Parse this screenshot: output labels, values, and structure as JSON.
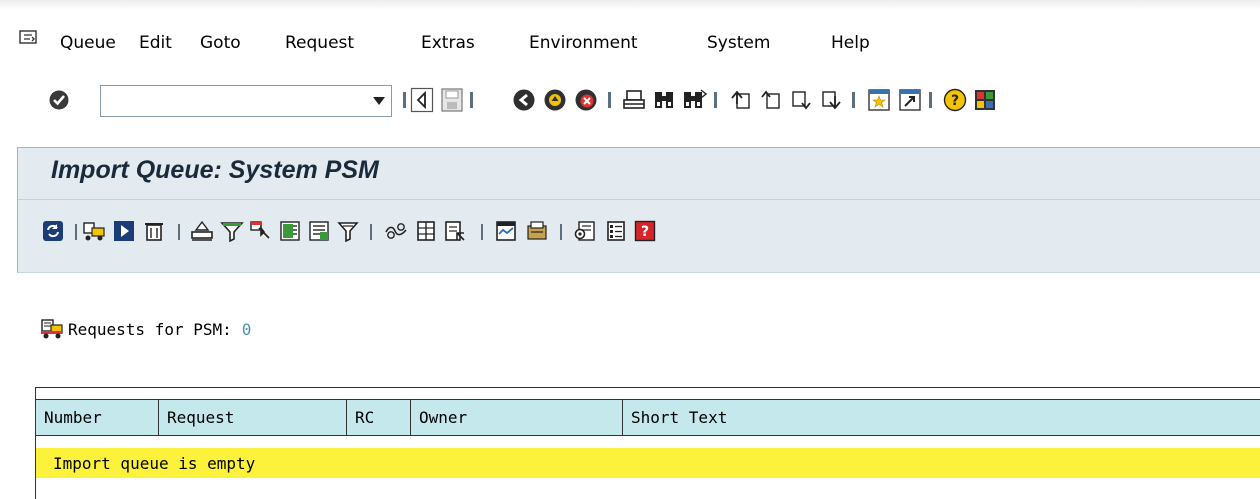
{
  "menu": {
    "items": [
      {
        "label": "Queue"
      },
      {
        "label": "Edit"
      },
      {
        "label": "Goto"
      },
      {
        "label": "Request"
      },
      {
        "label": "Extras"
      },
      {
        "label": "Environment"
      },
      {
        "label": "System"
      },
      {
        "label": "Help"
      }
    ]
  },
  "system_toolbar": {
    "command_field_value": "",
    "icons": [
      "enter-icon",
      "back-icon",
      "save-icon",
      "green-back-icon",
      "exit-icon",
      "cancel-icon",
      "print-icon",
      "find-icon",
      "find-next-icon",
      "first-page-icon",
      "previous-page-icon",
      "next-page-icon",
      "last-page-icon",
      "create-session-icon",
      "shortcut-icon",
      "help-icon",
      "layout-icon"
    ]
  },
  "page": {
    "title": "Import Queue: System PSM"
  },
  "app_toolbar": {
    "icons": [
      "refresh-icon",
      "import-request-icon",
      "start-import-icon",
      "delete-icon",
      "select-icon",
      "filter-icon",
      "select-block-icon",
      "select-all-icon",
      "deselect-all-icon",
      "funnel-icon",
      "logs-icon",
      "details-icon",
      "view-details-icon",
      "monitor-icon",
      "tools-icon",
      "settings-icon",
      "list-icon",
      "legend-icon"
    ]
  },
  "requests": {
    "label": "Requests for PSM:",
    "count": "0"
  },
  "table": {
    "columns": [
      "Number",
      "Request",
      "RC",
      "Owner",
      "Short Text"
    ],
    "empty_message": "Import queue is empty"
  },
  "colors": {
    "header_bg": "#c4e8ec",
    "empty_row_bg": "#fdf23b",
    "title_band_bg": "#e3ebf1"
  }
}
